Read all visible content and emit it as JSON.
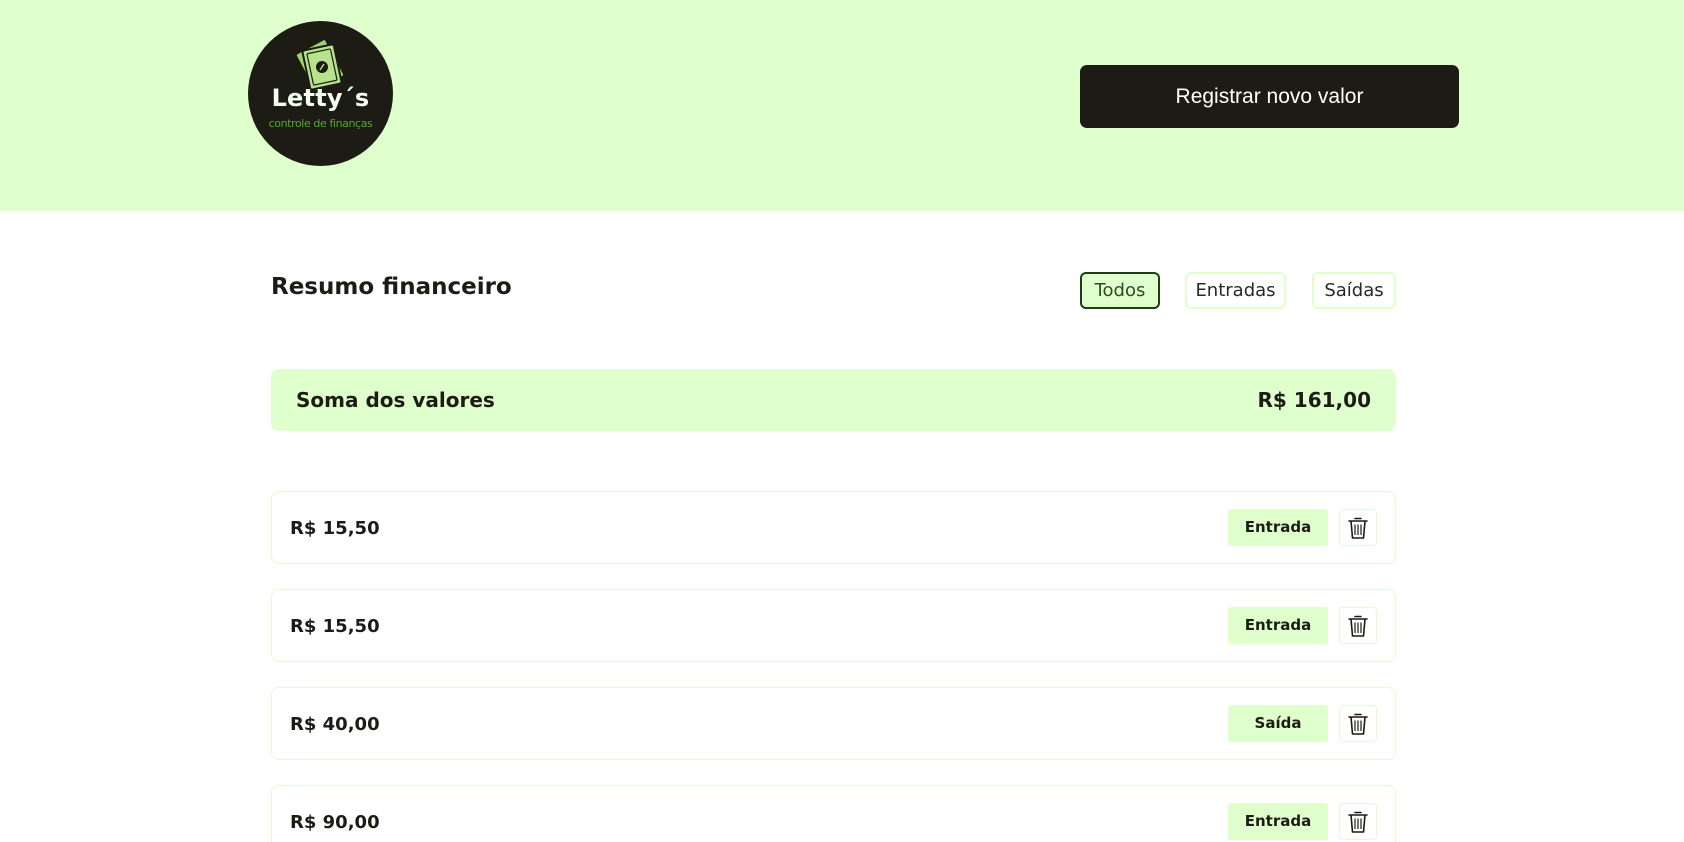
{
  "header": {
    "logo": {
      "name": "Letty´s",
      "subtitle": "controle de finanças",
      "icon": "money-bills-icon"
    },
    "register_button": "Registrar novo valor"
  },
  "summary": {
    "title": "Resumo financeiro",
    "filters": [
      {
        "label": "Todos",
        "active": true
      },
      {
        "label": "Entradas",
        "active": false
      },
      {
        "label": "Saídas",
        "active": false
      }
    ],
    "total_label": "Soma dos valores",
    "total_value": "R$ 161,00"
  },
  "entries": [
    {
      "value": "R$ 15,50",
      "type": "Entrada"
    },
    {
      "value": "R$ 15,50",
      "type": "Entrada"
    },
    {
      "value": "R$ 40,00",
      "type": "Saída"
    },
    {
      "value": "R$ 90,00",
      "type": "Entrada"
    }
  ],
  "icons": {
    "delete": "trash-icon"
  },
  "colors": {
    "brand_light": "#dfffcc",
    "brand_dark": "#1c1c14",
    "logo_accent": "#5aa52f"
  }
}
